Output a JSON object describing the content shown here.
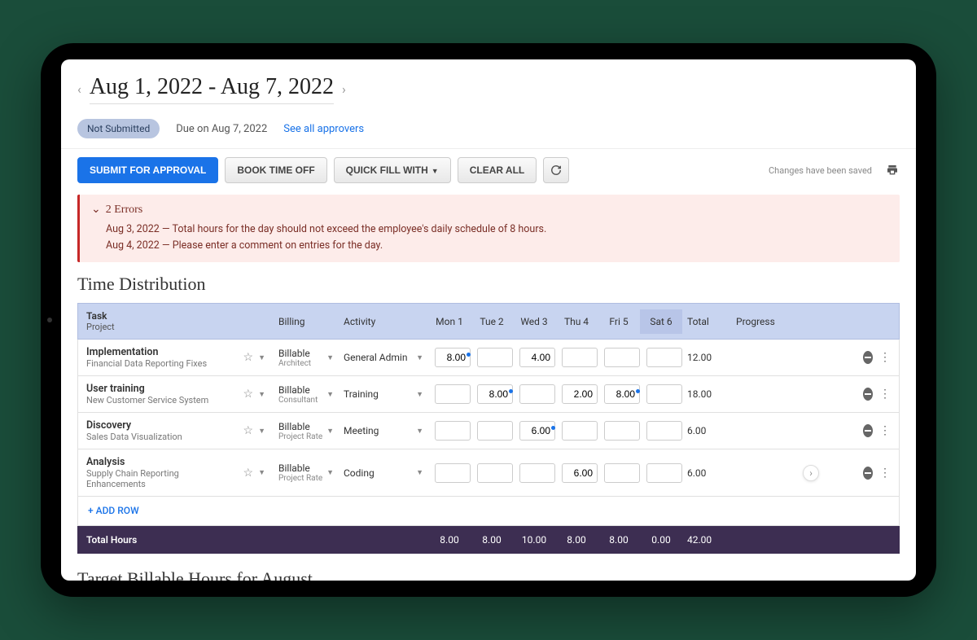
{
  "header": {
    "date_range": "Aug 1, 2022 - Aug 7, 2022",
    "status_badge": "Not Submitted",
    "due_text": "Due on Aug 7, 2022",
    "approvers_link": "See all approvers"
  },
  "toolbar": {
    "submit": "SUBMIT FOR APPROVAL",
    "book_time_off": "BOOK TIME OFF",
    "quick_fill": "QUICK FILL WITH",
    "clear_all": "CLEAR ALL",
    "saved_text": "Changes have been saved"
  },
  "errors": {
    "header": "2 Errors",
    "items": [
      "Aug 3, 2022 — Total hours for the day should not exceed the employee's daily schedule of 8 hours.",
      "Aug 4, 2022 — Please enter a comment on entries for the day."
    ]
  },
  "section_title": "Time Distribution",
  "columns": {
    "task": "Task",
    "project": "Project",
    "billing": "Billing",
    "activity": "Activity",
    "days": [
      "Mon 1",
      "Tue 2",
      "Wed 3",
      "Thu 4",
      "Fri 5",
      "Sat 6"
    ],
    "total": "Total",
    "progress": "Progress"
  },
  "rows": [
    {
      "task": "Implementation",
      "project": "Financial Data Reporting Fixes",
      "billing": "Billable",
      "billing_sub": "Architect",
      "activity": "General Admin",
      "hours": [
        "8.00",
        "",
        "4.00",
        "",
        "",
        ""
      ],
      "dots": [
        true,
        false,
        false,
        false,
        false,
        false
      ],
      "total": "12.00"
    },
    {
      "task": "User training",
      "project": "New Customer Service System",
      "billing": "Billable",
      "billing_sub": "Consultant",
      "activity": "Training",
      "hours": [
        "",
        "8.00",
        "",
        "2.00",
        "8.00",
        ""
      ],
      "dots": [
        false,
        true,
        false,
        false,
        true,
        false
      ],
      "total": "18.00"
    },
    {
      "task": "Discovery",
      "project": "Sales Data Visualization",
      "billing": "Billable",
      "billing_sub": "Project Rate",
      "activity": "Meeting",
      "hours": [
        "",
        "",
        "6.00",
        "",
        "",
        ""
      ],
      "dots": [
        false,
        false,
        true,
        false,
        false,
        false
      ],
      "total": "6.00"
    },
    {
      "task": "Analysis",
      "project": "Supply Chain Reporting Enhancements",
      "billing": "Billable",
      "billing_sub": "Project Rate",
      "activity": "Coding",
      "hours": [
        "",
        "",
        "",
        "6.00",
        "",
        ""
      ],
      "dots": [
        false,
        false,
        false,
        false,
        false,
        false
      ],
      "total": "6.00"
    }
  ],
  "add_row": "+ ADD ROW",
  "totals": {
    "label": "Total Hours",
    "days": [
      "8.00",
      "8.00",
      "10.00",
      "8.00",
      "8.00",
      "0.00"
    ],
    "grand": "42.00"
  },
  "section2_title": "Target Billable Hours for August"
}
